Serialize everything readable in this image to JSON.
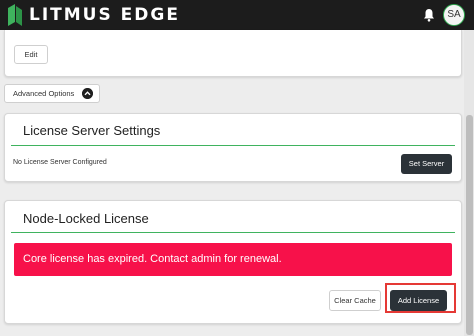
{
  "header": {
    "brand": "LITMUS EDGE",
    "avatar_initials": "SA",
    "icons": {
      "logo": "litmus-logo-icon",
      "notifications": "bell-icon"
    },
    "colors": {
      "background": "#1c1c1c",
      "avatar_border": "#2fa84f"
    }
  },
  "edit_section": {
    "edit_label": "Edit"
  },
  "advanced_options": {
    "label": "Advanced Options",
    "icon": "chevron-up-icon"
  },
  "license_server": {
    "title": "License Server Settings",
    "status_text": "No License Server Configured",
    "set_server_label": "Set Server"
  },
  "node_locked": {
    "title": "Node-Locked License",
    "alert_text": "Core license has expired. Contact admin for renewal.",
    "clear_cache_label": "Clear Cache",
    "add_license_label": "Add License"
  },
  "colors": {
    "accent_green": "#3fb35e",
    "alert_red": "#f7114a",
    "primary_button": "#2b3238",
    "highlight_outline": "#e53935"
  }
}
